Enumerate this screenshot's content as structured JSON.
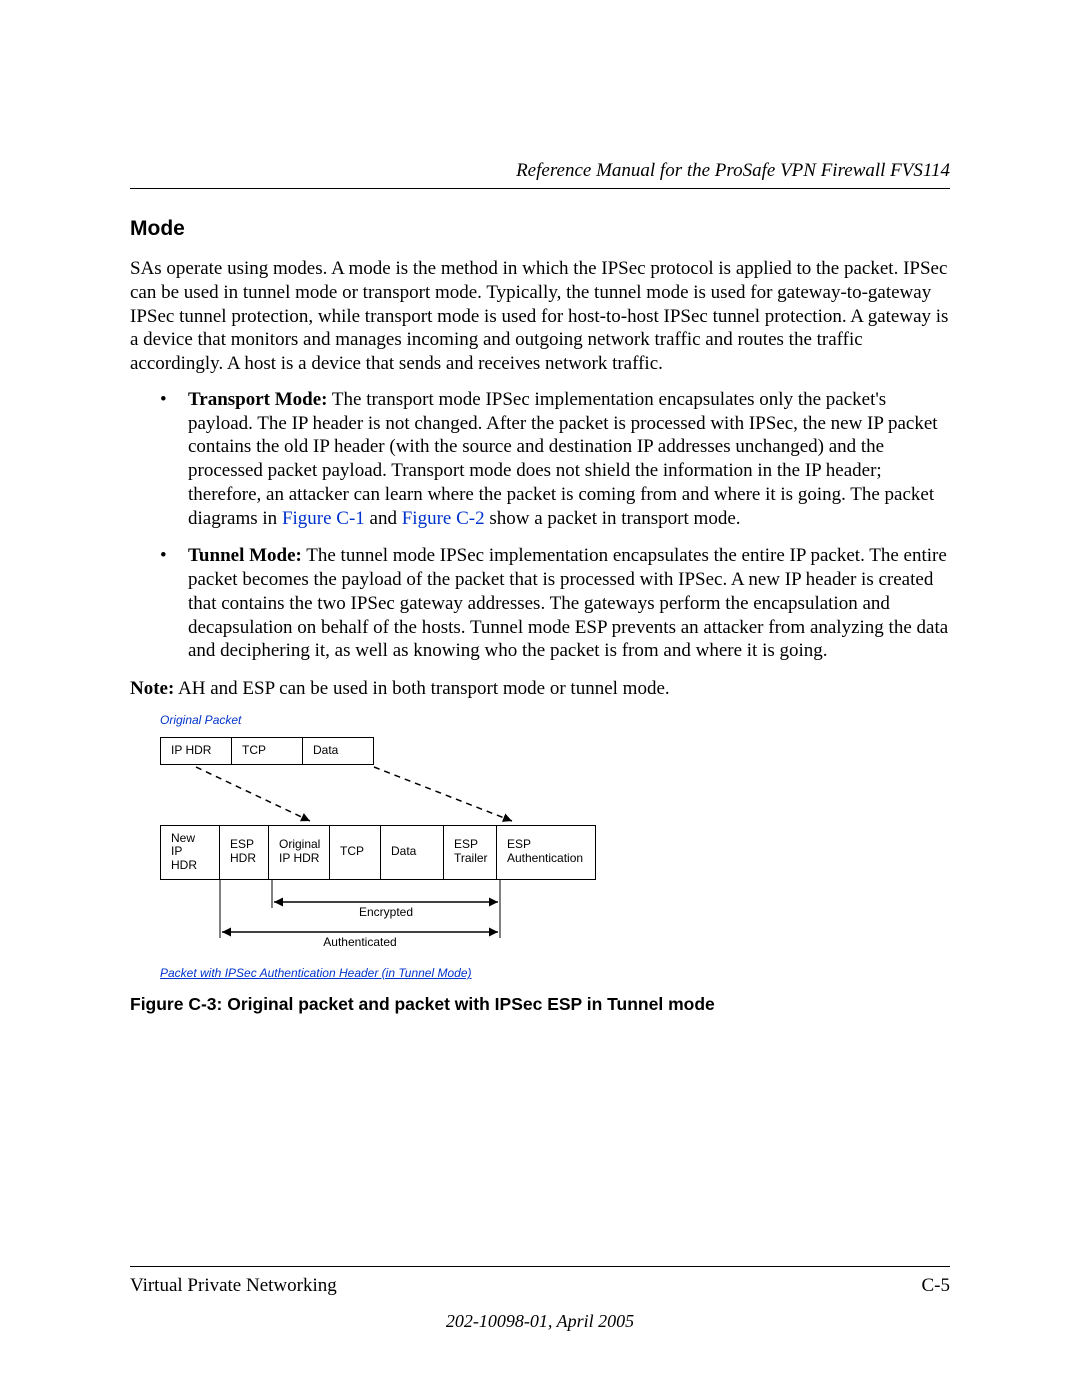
{
  "header": {
    "running_head": "Reference Manual for the ProSafe VPN Firewall FVS114"
  },
  "section": {
    "heading": "Mode",
    "intro": "SAs operate using modes. A mode is the method in which the IPSec protocol is applied to the packet. IPSec can be used in tunnel mode or transport mode. Typically, the tunnel mode is used for gateway-to-gateway IPSec tunnel protection, while transport mode is used for host-to-host IPSec tunnel protection. A gateway is a device that monitors and manages incoming and outgoing network traffic and routes the traffic accordingly. A host is a device that sends and receives network traffic.",
    "bullets": [
      {
        "run_in": "Transport Mode:",
        "text_before_links": " The transport mode IPSec implementation encapsulates only the packet's payload. The IP header is not changed. After the packet is processed with IPSec, the new IP packet contains the old IP header (with the source and destination IP addresses unchanged) and the processed packet payload. Transport mode does not shield the information in the IP header; therefore, an attacker can learn where the packet is coming from and where it is going. The packet diagrams in ",
        "link1": "Figure C-1",
        "mid": " and ",
        "link2": "Figure C-2",
        "text_after_links": " show a packet in transport mode."
      },
      {
        "run_in": "Tunnel Mode:",
        "text": " The tunnel mode IPSec implementation encapsulates the entire IP packet. The entire packet becomes the payload of the packet that is processed with IPSec. A new IP header is created that contains the two IPSec gateway addresses. The gateways perform the encapsulation and decapsulation on behalf of the hosts. Tunnel mode ESP prevents an attacker from analyzing the data and deciphering it, as well as knowing who the packet is from and where it is going."
      }
    ],
    "note_label": "Note:",
    "note_text": " AH and ESP can be used in both transport mode or tunnel mode."
  },
  "figure": {
    "top_label": "Original Packet",
    "row1": [
      "IP HDR",
      "TCP",
      "Data"
    ],
    "row2": [
      "New\nIP HDR",
      "ESP\nHDR",
      "Original\nIP HDR",
      "TCP",
      "Data",
      "ESP\nTrailer",
      "ESP\nAuthentication"
    ],
    "encrypted_label": "Encrypted",
    "authenticated_label": "Authenticated",
    "bottom_label": "Packet with IPSec Authentication Header (in Tunnel Mode)",
    "caption": "Figure C-3:  Original packet and packet with IPSec ESP in Tunnel mode"
  },
  "footer": {
    "left": "Virtual Private Networking",
    "right": "C-5",
    "docid": "202-10098-01, April 2005"
  }
}
